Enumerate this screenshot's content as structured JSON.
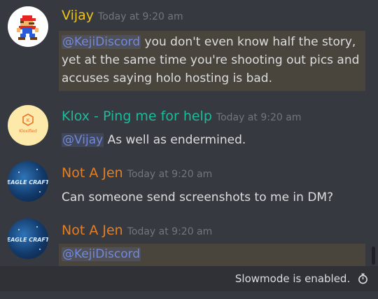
{
  "messages": [
    {
      "author": "Vijay",
      "author_color": "#f1c40f",
      "timestamp": "Today at 9:20 am",
      "avatar": "mario-pixel-avatar",
      "mention": "@KejiDiscord",
      "text_line1": " you don't even know half the story,",
      "text_line2": "yet at the same time you're shooting out pics and",
      "text_line3": "accuses saying holo hosting is bad."
    },
    {
      "author": "Klox - Ping me for help",
      "author_color": "#1abc9c",
      "timestamp": "Today at 9:20 am",
      "avatar_text": "Kloxified",
      "mention": "@Vijay",
      "text": " As well as endermined."
    },
    {
      "author": "Not A Jen",
      "author_color": "#e67e22",
      "timestamp": "Today at 9:20 am",
      "avatar_text": "EAGLE CRAFT",
      "text": "Can someone send screenshots to me in DM?"
    },
    {
      "author": "Not A Jen",
      "author_color": "#e67e22",
      "timestamp": "Today at 9:20 am",
      "avatar_text": "EAGLE CRAFT",
      "mention": "@KejiDiscord"
    }
  ],
  "status": {
    "slowmode_text": "Slowmode is enabled.",
    "icon": "stopwatch-icon"
  },
  "colors": {
    "background": "#36393f",
    "mention_highlight": "#49443c",
    "mention_text": "#7289da",
    "timestamp": "#72767d"
  }
}
